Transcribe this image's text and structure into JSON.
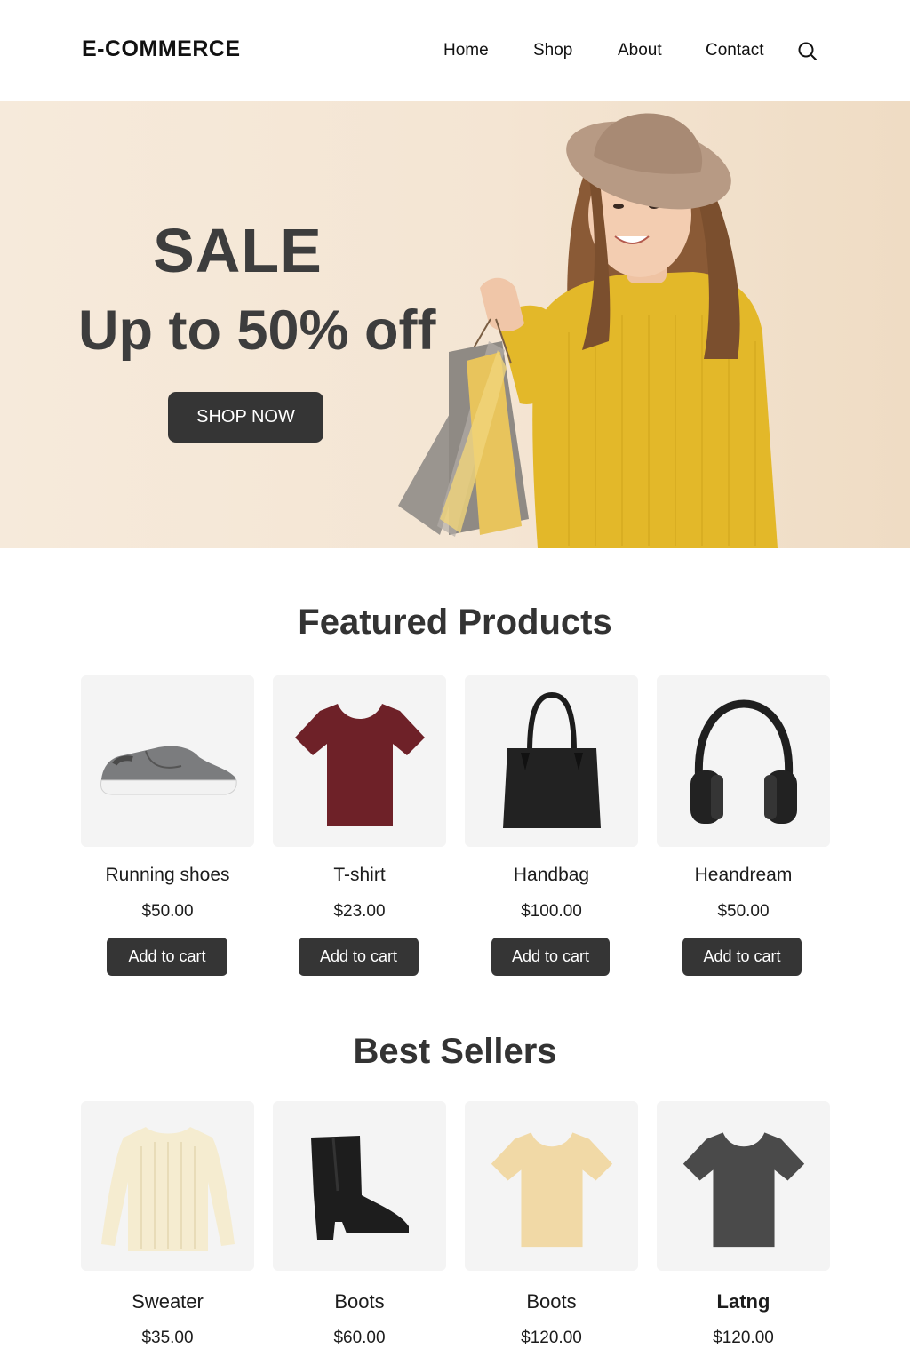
{
  "header": {
    "logo": "E-COMMERCE",
    "nav": [
      "Home",
      "Shop",
      "About",
      "Contact"
    ],
    "search_icon": "search-icon"
  },
  "hero": {
    "title": "SALE",
    "subtitle": "Up to 50% off",
    "button": "SHOP NOW",
    "colors": {
      "background": "#f5e8d7",
      "sweater": "#e3b829",
      "hat": "#b79a84"
    }
  },
  "featured": {
    "title": "Featured Products",
    "products": [
      {
        "name": "Running shoes",
        "price": "$50.00",
        "button": "Add to cart",
        "icon": "sneaker-icon"
      },
      {
        "name": "T-shirt",
        "price": "$23.00",
        "button": "Add to cart",
        "icon": "tshirt-icon"
      },
      {
        "name": "Handbag",
        "price": "$100.00",
        "button": "Add to cart",
        "icon": "handbag-icon"
      },
      {
        "name": "Heandream",
        "price": "$50.00",
        "button": "Add to cart",
        "icon": "headphones-icon"
      }
    ]
  },
  "best_sellers": {
    "title": "Best Sellers",
    "products": [
      {
        "name": "Sweater",
        "price": "$35.00",
        "icon": "sweater-icon"
      },
      {
        "name": "Boots",
        "price": "$60.00",
        "icon": "boot-icon"
      },
      {
        "name": "Boots",
        "price": "$120.00",
        "icon": "tshirt-icon"
      },
      {
        "name": "Latng",
        "price": "$120.00",
        "icon": "tshirt-icon"
      }
    ]
  },
  "colors": {
    "button_bg": "#353535",
    "card_bg": "#f4f4f4",
    "text": "#2b2b2b"
  }
}
